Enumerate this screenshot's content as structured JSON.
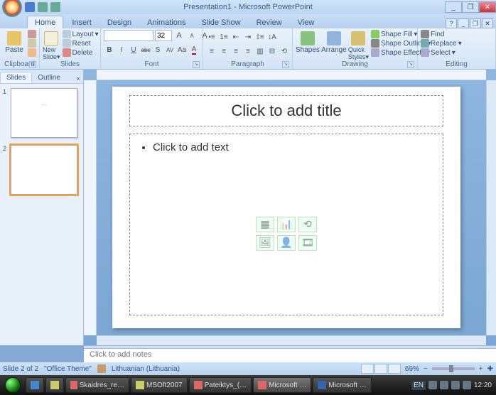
{
  "window": {
    "title": "Presentation1 - Microsoft PowerPoint",
    "min": "_",
    "max": "❐",
    "close": "✕"
  },
  "tabs": {
    "items": [
      "Home",
      "Insert",
      "Design",
      "Animations",
      "Slide Show",
      "Review",
      "View"
    ],
    "active": 0
  },
  "ribbon": {
    "clipboard": {
      "label": "Clipboard",
      "paste": "Paste",
      "cut": "Cut",
      "copy": "Copy",
      "fmt": "Format Painter"
    },
    "slides": {
      "label": "Slides",
      "new": "New\nSlide",
      "layout": "Layout",
      "reset": "Reset",
      "delete": "Delete"
    },
    "font": {
      "label": "Font",
      "size": "32",
      "grow": "A",
      "shrink": "A",
      "bold": "B",
      "italic": "I",
      "underline": "U",
      "strike": "abc",
      "shadow": "S",
      "spacing": "AV",
      "case": "Aa",
      "clear": "A"
    },
    "paragraph": {
      "label": "Paragraph"
    },
    "drawing": {
      "label": "Drawing",
      "shapes": "Shapes",
      "arrange": "Arrange",
      "qstyles": "Quick\nStyles",
      "fill": "Shape Fill",
      "outline": "Shape Outline",
      "effects": "Shape Effects"
    },
    "editing": {
      "label": "Editing",
      "find": "Find",
      "replace": "Replace",
      "select": "Select"
    }
  },
  "sidepanel": {
    "tab_slides": "Slides",
    "tab_outline": "Outline",
    "thumbs": [
      {
        "num": "1",
        "text": "····"
      },
      {
        "num": "2",
        "text": ""
      }
    ],
    "selected": 1
  },
  "slide": {
    "title_placeholder": "Click to add title",
    "body_placeholder": "Click to add text"
  },
  "notes": {
    "placeholder": "Click to add notes"
  },
  "status": {
    "slide": "Slide 2 of 2",
    "theme": "\"Office Theme\"",
    "language": "Lithuanian (Lithuania)",
    "zoom": "69%",
    "fit": "✚"
  },
  "taskbar": {
    "items": [
      {
        "label": "Skaidres_re…"
      },
      {
        "label": "MSOft2007"
      },
      {
        "label": "Pateiktys_(…"
      },
      {
        "label": "Microsoft …",
        "active": true
      },
      {
        "label": "Microsoft …"
      }
    ],
    "lang": "EN",
    "time": "12:20"
  }
}
